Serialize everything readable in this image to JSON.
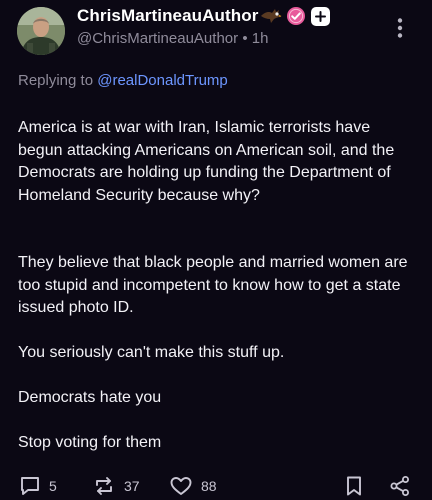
{
  "author": {
    "display_name": "ChrisMartineauAuthor",
    "handle": "@ChrisMartineauAuthor",
    "separator": "•",
    "timestamp": "1h"
  },
  "reply": {
    "prefix": "Replying to",
    "to": "@realDonaldTrump"
  },
  "post": {
    "paragraphs": [
      "America is at war with Iran, Islamic terrorists have begun attacking Americans on American soil, and the Democrats are holding up funding the Department of Homeland Security because why?",
      "They believe that black people and married women are too stupid and incompetent to know how to get a state issued photo ID.",
      "You seriously can't make this stuff up.",
      "Democrats hate you",
      "Stop voting for them"
    ]
  },
  "actions": {
    "replies": "5",
    "reposts": "37",
    "likes": "88"
  },
  "icons": {
    "name_emoji": "eagle-icon",
    "verified": "verified-badge-icon",
    "follow": "plus-icon",
    "more": "vertical-ellipsis-icon",
    "reply": "speech-bubble-icon",
    "repost": "repost-arrows-icon",
    "like": "heart-icon",
    "bookmark": "bookmark-icon",
    "share": "share-icon"
  },
  "colors": {
    "background": "#0b0814",
    "text": "#f3f2f7",
    "muted": "#8f8b9a",
    "link": "#6d96ff",
    "verified": "#e85a9b"
  }
}
